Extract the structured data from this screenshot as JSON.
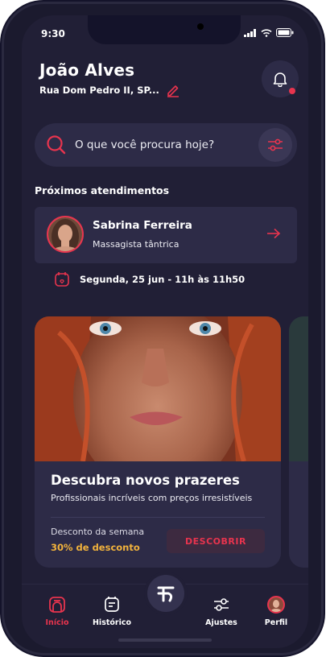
{
  "status": {
    "time": "9:30"
  },
  "header": {
    "user_name": "João Alves",
    "address": "Rua Dom Pedro II, SP..."
  },
  "search": {
    "placeholder": "O que você procura hoje?"
  },
  "appointments": {
    "title": "Próximos atendimentos",
    "card": {
      "name": "Sabrina Ferreira",
      "role": "Massagista tântrica",
      "date": "Segunda, 25 jun - 11h às 11h50"
    }
  },
  "promo": {
    "title": "Descubra novos prazeres",
    "subtitle": "Profissionais incríveis com preços irresistíveis",
    "discount_label": "Desconto da semana",
    "discount_value": "30% de desconto",
    "button_label": "DESCOBRIR"
  },
  "tabbar": {
    "items": [
      {
        "label": "Início",
        "icon": "home-icon",
        "active": true
      },
      {
        "label": "Histórico",
        "icon": "history-icon",
        "active": false
      },
      {
        "label": "",
        "icon": "logo-icon",
        "active": false
      },
      {
        "label": "Ajustes",
        "icon": "settings-icon",
        "active": false
      },
      {
        "label": "Perfil",
        "icon": "avatar",
        "active": false
      }
    ]
  },
  "colors": {
    "accent": "#e8344e",
    "background": "#211f36",
    "card": "#2d2b47",
    "discount": "#f1b23c"
  }
}
